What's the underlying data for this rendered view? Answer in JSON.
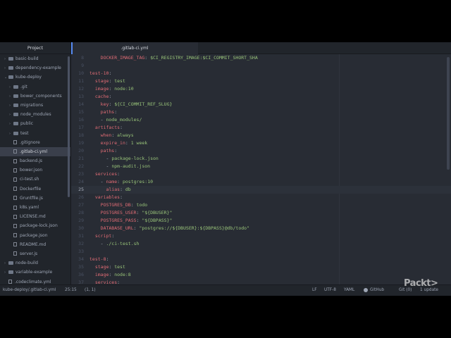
{
  "tree": {
    "header": "Project",
    "items": [
      {
        "label": "basic-build",
        "type": "folder",
        "depth": 0,
        "arrow": "›",
        "selected": false
      },
      {
        "label": "dependency-example",
        "type": "folder",
        "depth": 0,
        "arrow": "›",
        "selected": false
      },
      {
        "label": "kube-deploy",
        "type": "folder",
        "depth": 0,
        "arrow": "⌄",
        "selected": false
      },
      {
        "label": ".git",
        "type": "folder",
        "depth": 1,
        "arrow": "›",
        "selected": false
      },
      {
        "label": "bower_components",
        "type": "folder",
        "depth": 1,
        "arrow": "›",
        "selected": false
      },
      {
        "label": "migrations",
        "type": "folder",
        "depth": 1,
        "arrow": "›",
        "selected": false
      },
      {
        "label": "node_modules",
        "type": "folder",
        "depth": 1,
        "arrow": "›",
        "selected": false
      },
      {
        "label": "public",
        "type": "folder",
        "depth": 1,
        "arrow": "›",
        "selected": false
      },
      {
        "label": "test",
        "type": "folder",
        "depth": 1,
        "arrow": "›",
        "selected": false
      },
      {
        "label": ".gitignore",
        "type": "file",
        "depth": 1,
        "arrow": "",
        "selected": false
      },
      {
        "label": ".gitlab-ci.yml",
        "type": "file",
        "depth": 1,
        "arrow": "",
        "selected": true
      },
      {
        "label": "backend.js",
        "type": "file",
        "depth": 1,
        "arrow": "",
        "selected": false
      },
      {
        "label": "bower.json",
        "type": "file",
        "depth": 1,
        "arrow": "",
        "selected": false
      },
      {
        "label": "ci-test.sh",
        "type": "file",
        "depth": 1,
        "arrow": "",
        "selected": false
      },
      {
        "label": "Dockerfile",
        "type": "file",
        "depth": 1,
        "arrow": "",
        "selected": false
      },
      {
        "label": "Gruntfile.js",
        "type": "file",
        "depth": 1,
        "arrow": "",
        "selected": false
      },
      {
        "label": "k8s.yaml",
        "type": "file",
        "depth": 1,
        "arrow": "",
        "selected": false
      },
      {
        "label": "LICENSE.md",
        "type": "file",
        "depth": 1,
        "arrow": "",
        "selected": false
      },
      {
        "label": "package-lock.json",
        "type": "file",
        "depth": 1,
        "arrow": "",
        "selected": false
      },
      {
        "label": "package.json",
        "type": "file",
        "depth": 1,
        "arrow": "",
        "selected": false
      },
      {
        "label": "README.md",
        "type": "file",
        "depth": 1,
        "arrow": "",
        "selected": false
      },
      {
        "label": "server.js",
        "type": "file",
        "depth": 1,
        "arrow": "",
        "selected": false
      },
      {
        "label": "node-build",
        "type": "folder",
        "depth": 0,
        "arrow": "›",
        "selected": false
      },
      {
        "label": "variable-example",
        "type": "folder",
        "depth": 0,
        "arrow": "›",
        "selected": false
      },
      {
        "label": ".codeclimate.yml",
        "type": "file",
        "depth": 0,
        "arrow": "",
        "selected": false
      }
    ]
  },
  "tab": {
    "label": ".gitlab-ci.yml"
  },
  "editor": {
    "cursor_line": 25,
    "lines": [
      {
        "n": "8",
        "parts": [
          [
            "    ",
            "p"
          ],
          [
            "DOCKER_IMAGE_TAG",
            "k"
          ],
          [
            ": ",
            "p"
          ],
          [
            "$CI_REGISTRY_IMAGE:$CI_COMMIT_SHORT_SHA",
            "s"
          ]
        ]
      },
      {
        "n": "9",
        "parts": []
      },
      {
        "n": "10",
        "parts": [
          [
            "test-10",
            "k"
          ],
          [
            ":",
            "p"
          ]
        ]
      },
      {
        "n": "11",
        "parts": [
          [
            "  ",
            "p"
          ],
          [
            "stage",
            "k"
          ],
          [
            ": ",
            "p"
          ],
          [
            "test",
            "s"
          ]
        ]
      },
      {
        "n": "12",
        "parts": [
          [
            "  ",
            "p"
          ],
          [
            "image",
            "k"
          ],
          [
            ": ",
            "p"
          ],
          [
            "node:10",
            "s"
          ]
        ]
      },
      {
        "n": "13",
        "parts": [
          [
            "  ",
            "p"
          ],
          [
            "cache",
            "k"
          ],
          [
            ":",
            "p"
          ]
        ]
      },
      {
        "n": "14",
        "parts": [
          [
            "    ",
            "p"
          ],
          [
            "key",
            "k"
          ],
          [
            ": ",
            "p"
          ],
          [
            "${CI_COMMIT_REF_SLUG}",
            "s"
          ]
        ]
      },
      {
        "n": "15",
        "parts": [
          [
            "    ",
            "p"
          ],
          [
            "paths",
            "k"
          ],
          [
            ":",
            "p"
          ]
        ]
      },
      {
        "n": "16",
        "parts": [
          [
            "    - ",
            "p"
          ],
          [
            "node_modules/",
            "s"
          ]
        ]
      },
      {
        "n": "17",
        "parts": [
          [
            "  ",
            "p"
          ],
          [
            "artifacts",
            "k"
          ],
          [
            ":",
            "p"
          ]
        ]
      },
      {
        "n": "18",
        "parts": [
          [
            "    ",
            "p"
          ],
          [
            "when",
            "k"
          ],
          [
            ": ",
            "p"
          ],
          [
            "always",
            "s"
          ]
        ]
      },
      {
        "n": "19",
        "parts": [
          [
            "    ",
            "p"
          ],
          [
            "expire_in",
            "k"
          ],
          [
            ": ",
            "p"
          ],
          [
            "1 week",
            "s"
          ]
        ]
      },
      {
        "n": "20",
        "parts": [
          [
            "    ",
            "p"
          ],
          [
            "paths",
            "k"
          ],
          [
            ":",
            "p"
          ]
        ]
      },
      {
        "n": "21",
        "parts": [
          [
            "      - ",
            "p"
          ],
          [
            "package-lock.json",
            "s"
          ]
        ]
      },
      {
        "n": "22",
        "parts": [
          [
            "      - ",
            "p"
          ],
          [
            "npm-audit.json",
            "s"
          ]
        ]
      },
      {
        "n": "23",
        "parts": [
          [
            "  ",
            "p"
          ],
          [
            "services",
            "k"
          ],
          [
            ":",
            "p"
          ]
        ]
      },
      {
        "n": "24",
        "parts": [
          [
            "    - ",
            "p"
          ],
          [
            "name",
            "k"
          ],
          [
            ": ",
            "p"
          ],
          [
            "postgres:10",
            "s"
          ]
        ]
      },
      {
        "n": "25",
        "parts": [
          [
            "      ",
            "p"
          ],
          [
            "alias",
            "k"
          ],
          [
            ": ",
            "p"
          ],
          [
            "db",
            "s"
          ]
        ]
      },
      {
        "n": "26",
        "parts": [
          [
            "  ",
            "p"
          ],
          [
            "variables",
            "k"
          ],
          [
            ":",
            "p"
          ]
        ]
      },
      {
        "n": "27",
        "parts": [
          [
            "    ",
            "p"
          ],
          [
            "POSTGRES_DB",
            "k"
          ],
          [
            ": ",
            "p"
          ],
          [
            "todo",
            "s"
          ]
        ]
      },
      {
        "n": "28",
        "parts": [
          [
            "    ",
            "p"
          ],
          [
            "POSTGRES_USER",
            "k"
          ],
          [
            ": ",
            "p"
          ],
          [
            "\"${DBUSER}\"",
            "s"
          ]
        ]
      },
      {
        "n": "29",
        "parts": [
          [
            "    ",
            "p"
          ],
          [
            "POSTGRES_PASS",
            "k"
          ],
          [
            ": ",
            "p"
          ],
          [
            "\"${DBPASS}\"",
            "s"
          ]
        ]
      },
      {
        "n": "30",
        "parts": [
          [
            "    ",
            "p"
          ],
          [
            "DATABASE_URL",
            "k"
          ],
          [
            ": ",
            "p"
          ],
          [
            "\"postgres://${DBUSER}:${DBPASS}@db/todo\"",
            "s"
          ]
        ]
      },
      {
        "n": "31",
        "parts": [
          [
            "  ",
            "p"
          ],
          [
            "script",
            "k"
          ],
          [
            ":",
            "p"
          ]
        ]
      },
      {
        "n": "32",
        "parts": [
          [
            "    - ",
            "p"
          ],
          [
            "./ci-test.sh",
            "s"
          ]
        ]
      },
      {
        "n": "33",
        "parts": []
      },
      {
        "n": "34",
        "parts": [
          [
            "test-8",
            "k"
          ],
          [
            ":",
            "p"
          ]
        ]
      },
      {
        "n": "35",
        "parts": [
          [
            "  ",
            "p"
          ],
          [
            "stage",
            "k"
          ],
          [
            ": ",
            "p"
          ],
          [
            "test",
            "s"
          ]
        ]
      },
      {
        "n": "36",
        "parts": [
          [
            "  ",
            "p"
          ],
          [
            "image",
            "k"
          ],
          [
            ": ",
            "p"
          ],
          [
            "node:8",
            "s"
          ]
        ]
      },
      {
        "n": "37",
        "parts": [
          [
            "  ",
            "p"
          ],
          [
            "services",
            "k"
          ],
          [
            ":",
            "p"
          ]
        ]
      }
    ]
  },
  "status": {
    "path": "kube-deploy/.gitlab-ci.yml",
    "position": "25:15",
    "selection": "(1, 1)",
    "line_ending": "LF",
    "encoding": "UTF-8",
    "grammar": "YAML",
    "github": "GitHub",
    "git": "Git (0)",
    "update": "1 update"
  },
  "watermark": "Packt>",
  "colors": {
    "key": "#e06c75",
    "string": "#98c379",
    "accent": "#568af2",
    "bg": "#282c34",
    "panel": "#21252b"
  }
}
